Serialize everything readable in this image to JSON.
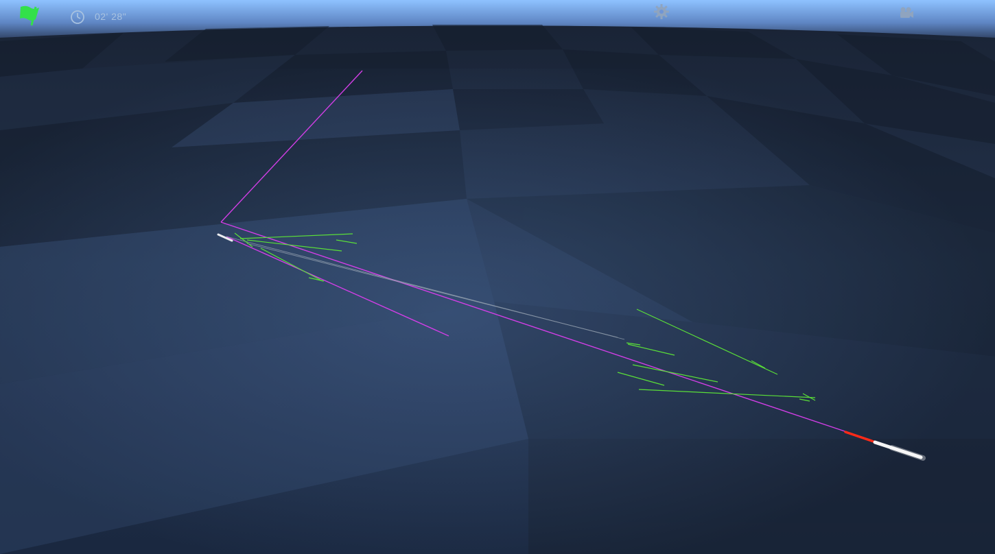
{
  "hud": {
    "flag_icon": "flag-icon",
    "flag_color": "#33e04a",
    "timer_icon": "clock-icon",
    "timer_text": "02' 28\"",
    "settings_icon": "gear-icon",
    "camera_icon": "camera-icon"
  },
  "scene": {
    "sky_color": "#8ec2ff",
    "floor_color": "#1e2d45",
    "trajectory_color": "#d23ee6",
    "guide_color": "#5be038",
    "vehicle_trail_color": "#ff3b22"
  }
}
